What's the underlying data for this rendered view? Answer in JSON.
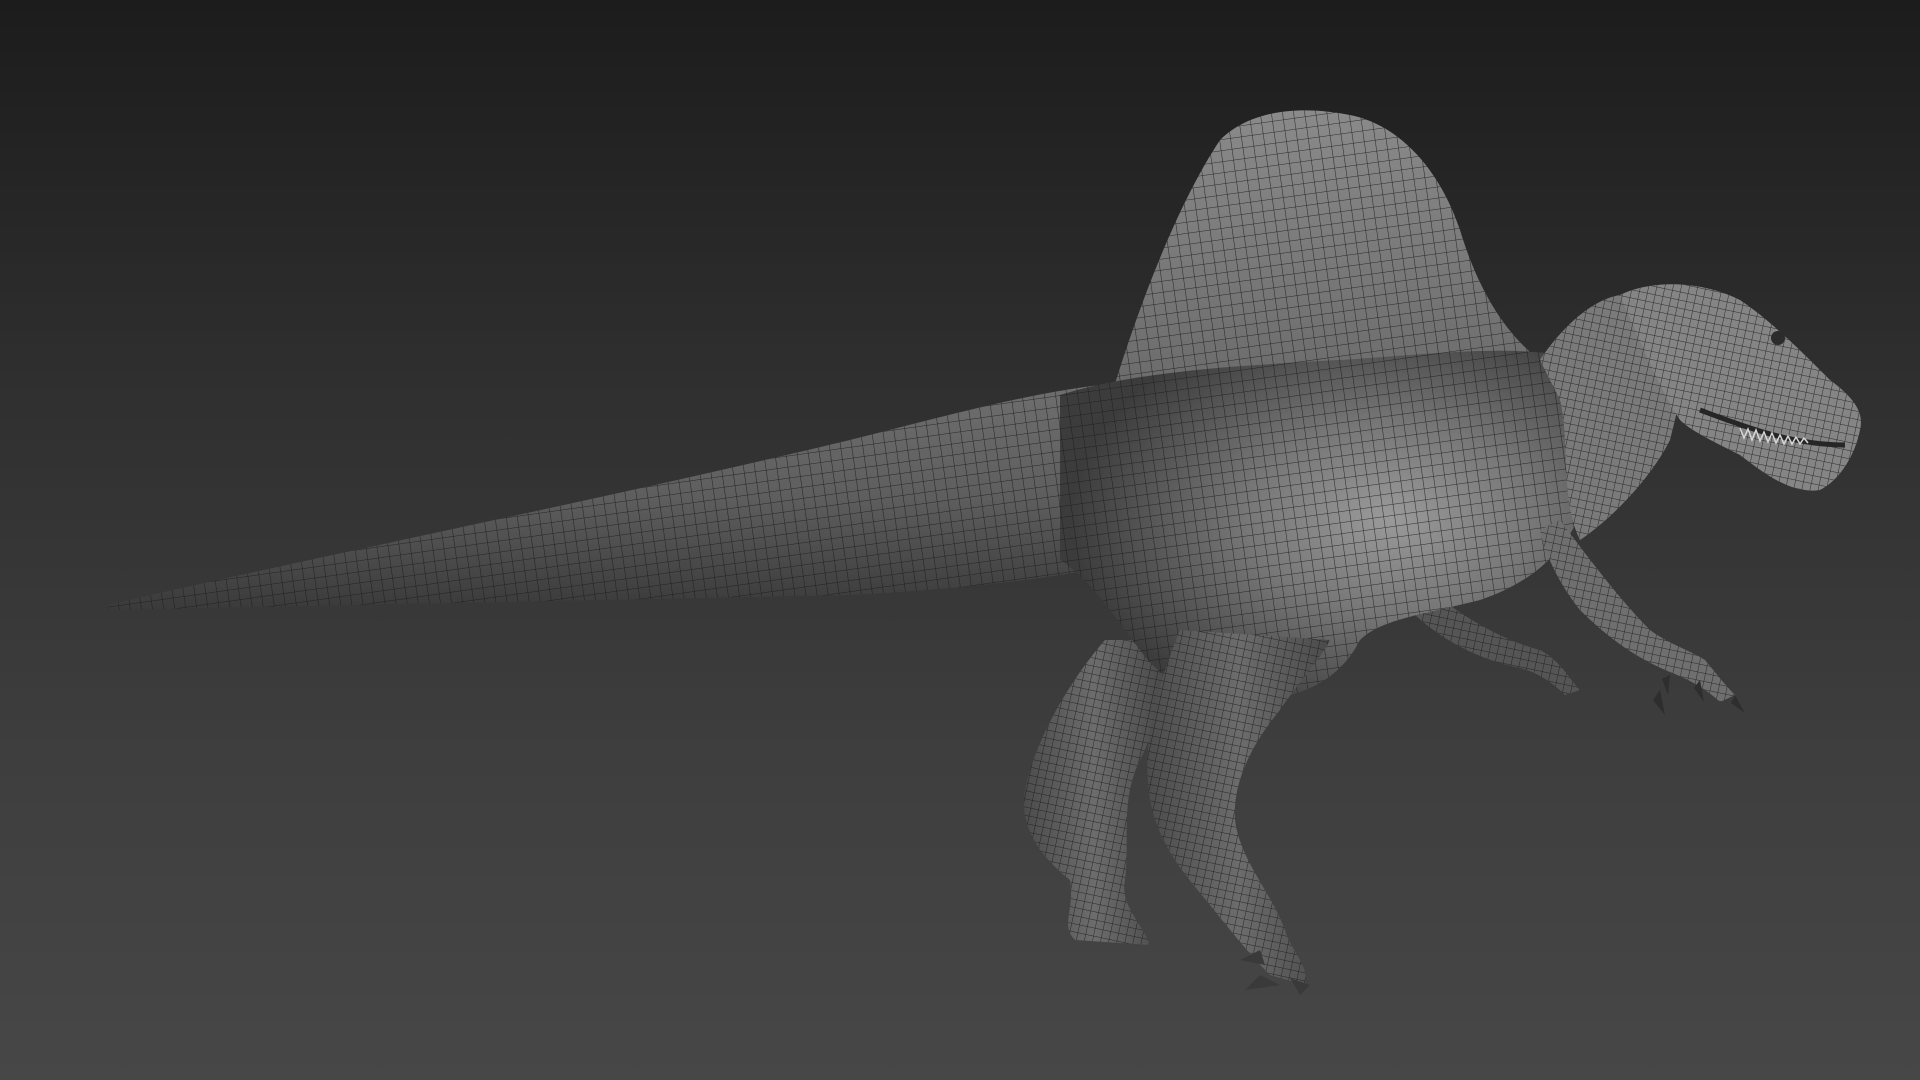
{
  "scene": {
    "subject": "spinosaurus-wireframe-model",
    "colors": {
      "background_top": "#1c1c1c",
      "background_bottom": "#474747",
      "body_light": "#8c8c8c",
      "body_mid": "#6a6a6a",
      "body_dark": "#3a3a3a",
      "wire": "#1e1e1e"
    }
  }
}
